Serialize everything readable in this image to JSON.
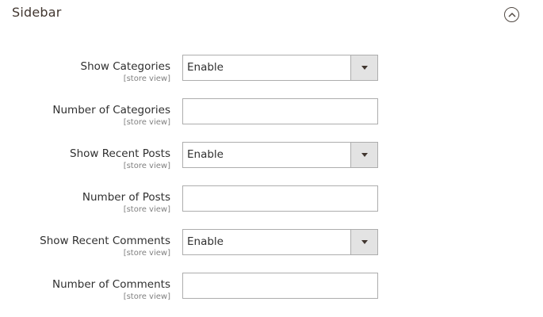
{
  "section": {
    "title": "Sidebar",
    "toggle_icon": "chevron-up-circle-icon"
  },
  "fields": [
    {
      "label": "Show Categories",
      "scope": "[store view]",
      "type": "select",
      "value": "Enable"
    },
    {
      "label": "Number of Categories",
      "scope": "[store view]",
      "type": "text",
      "value": ""
    },
    {
      "label": "Show Recent Posts",
      "scope": "[store view]",
      "type": "select",
      "value": "Enable"
    },
    {
      "label": "Number of Posts",
      "scope": "[store view]",
      "type": "text",
      "value": ""
    },
    {
      "label": "Show Recent Comments",
      "scope": "[store view]",
      "type": "select",
      "value": "Enable"
    },
    {
      "label": "Number of Comments",
      "scope": "[store view]",
      "type": "text",
      "value": ""
    }
  ]
}
